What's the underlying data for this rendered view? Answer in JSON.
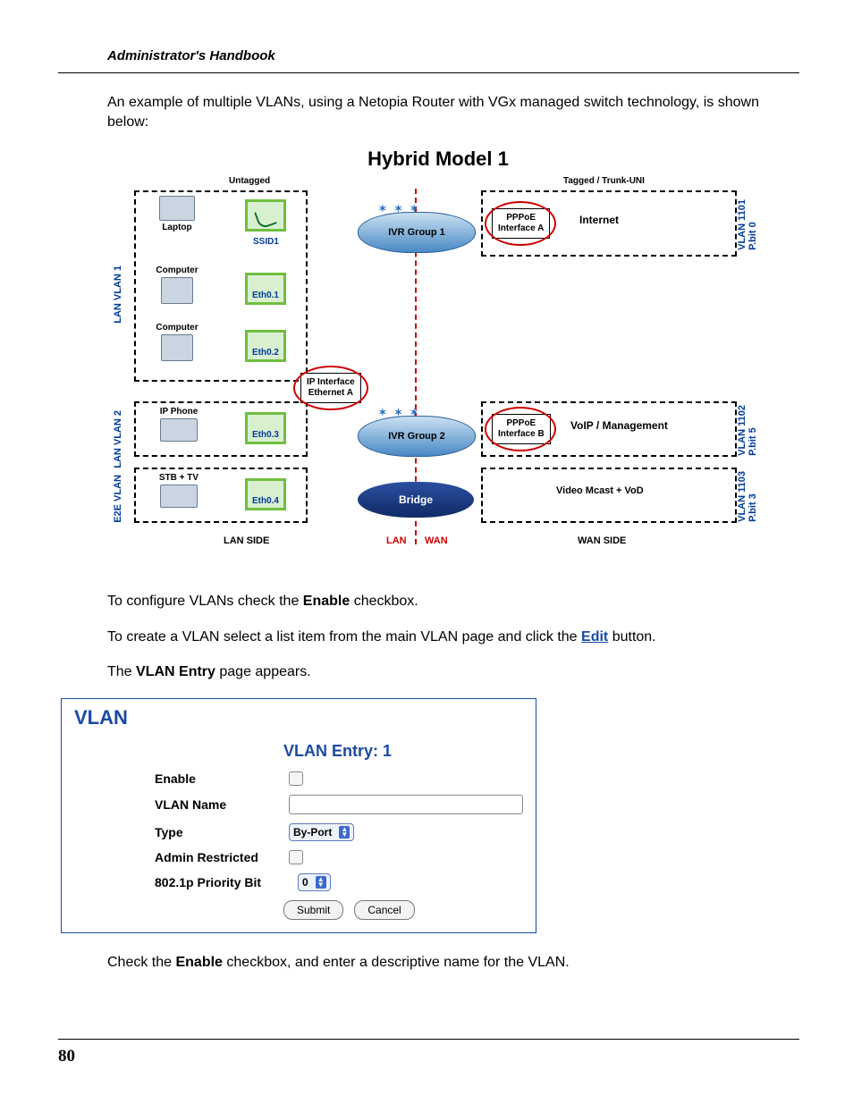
{
  "running_head": "Administrator's Handbook",
  "page_number": "80",
  "intro": "An example of multiple VLANs, using a Netopia Router with VGx managed switch technology, is shown below:",
  "diagram_title": "Hybrid Model 1",
  "diagram": {
    "top_left_label": "Untagged",
    "top_right_label": "Tagged  / Trunk-UNI",
    "left_groups": {
      "lan_vlan1": "LAN VLAN 1",
      "lan_vlan2": "LAN VLAN 2",
      "e2e_vlan": "E2E VLAN"
    },
    "devices": {
      "laptop": "Laptop",
      "computer": "Computer",
      "ip_phone": "IP Phone",
      "stb_tv": "STB + TV"
    },
    "chips": {
      "ssid1": "SSID1",
      "eth01": "Eth0.1",
      "eth02": "Eth0.2",
      "eth03": "Eth0.3",
      "eth04": "Eth0.4"
    },
    "groups": {
      "ivr1": "IVR Group 1",
      "ivr2": "IVR Group 2",
      "bridge": "Bridge",
      "ip_if": "IP Interface\nEthernet A"
    },
    "pppoe_a": "PPPoE\nInterface A",
    "pppoe_b": "PPPoE\nInterface B",
    "wan": {
      "internet": "Internet",
      "voip": "VoIP / Management",
      "video": "Video Mcast + VoD"
    },
    "right_groups": {
      "v1101": "VLAN 1101\nP.bit 0",
      "v1102": "VLAN 1102\nP.bit 5",
      "v1103": "VLAN 1103\nP.bit 3"
    },
    "footer": {
      "lan_side": "LAN SIDE",
      "lan": "LAN",
      "wan": "WAN",
      "wan_side": "WAN SIDE"
    }
  },
  "para1_a": "To configure VLANs check the ",
  "para1_b": "Enable",
  "para1_c": " checkbox.",
  "para2_a": "To create a VLAN select a list item from the main VLAN page and click the ",
  "para2_link": "Edit",
  "para2_c": " button.",
  "para3_a": "The ",
  "para3_b": "VLAN Entry",
  "para3_c": " page appears.",
  "shot": {
    "title": "VLAN",
    "subtitle": "VLAN Entry: 1",
    "rows": {
      "enable": "Enable",
      "name": "VLAN Name",
      "type": "Type",
      "type_val": "By-Port",
      "admin": "Admin Restricted",
      "pbit": "802.1p Priority Bit",
      "pbit_val": "0"
    },
    "submit": "Submit",
    "cancel": "Cancel"
  },
  "para4_a": "Check the ",
  "para4_b": "Enable",
  "para4_c": " checkbox, and enter a descriptive name for the VLAN."
}
